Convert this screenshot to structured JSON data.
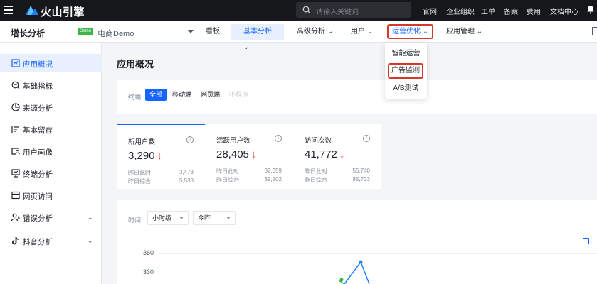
{
  "topbar": {
    "brand": "火山引擎",
    "search_placeholder": "请输入关键词",
    "links": [
      "官网",
      "企业组织",
      "工单",
      "备案",
      "费用",
      "文档中心"
    ]
  },
  "subbar": {
    "product": "增长分析",
    "badge": "Demo",
    "app_name": "电商Demo",
    "tabs": [
      "看板",
      "基本分析 ⌄",
      "高级分析 ⌄",
      "用户 ⌄",
      "运营优化 ⌄",
      "应用管理 ⌄"
    ],
    "highlighted_tab": "运营优化"
  },
  "sidebar": {
    "items": [
      {
        "label": "应用概况",
        "icon": "overview-icon"
      },
      {
        "label": "基础指标",
        "icon": "metrics-icon"
      },
      {
        "label": "来源分析",
        "icon": "source-icon"
      },
      {
        "label": "基本留存",
        "icon": "retention-icon"
      },
      {
        "label": "用户画像",
        "icon": "persona-icon"
      },
      {
        "label": "终端分析",
        "icon": "terminal-icon"
      },
      {
        "label": "网页访问",
        "icon": "webpage-icon"
      },
      {
        "label": "错误分析",
        "icon": "error-icon"
      },
      {
        "label": "抖音分析",
        "icon": "douyin-icon"
      }
    ],
    "active_index": 0
  },
  "main": {
    "title": "应用概况",
    "terminal_label": "终端:",
    "terminals": [
      "全部",
      "移动端",
      "网页端",
      "小程序"
    ],
    "metrics": [
      {
        "title": "新用户数",
        "value": "3,290",
        "trend": "↓",
        "cmp1_label": "昨日此时",
        "cmp1": "3,473",
        "cmp2_label": "昨日综合",
        "cmp2": "5,533"
      },
      {
        "title": "活跃用户数",
        "value": "28,405",
        "trend": "↓",
        "cmp1_label": "昨日此时",
        "cmp1": "32,359",
        "cmp2_label": "昨日综合",
        "cmp2": "39,202"
      },
      {
        "title": "访问次数",
        "value": "41,772",
        "trend": "↓",
        "cmp1_label": "昨日此时",
        "cmp1": "55,740",
        "cmp2_label": "昨日综合",
        "cmp2": "85,723"
      }
    ],
    "time_label": "时间:",
    "granularity": "小时级",
    "day": "今昨",
    "y_ticks": [
      "360",
      "330"
    ]
  },
  "dropdown": {
    "items": [
      "智能运营",
      "广告监测",
      "A/B测试"
    ],
    "highlighted": "广告监测"
  },
  "colors": {
    "accent": "#1664ff",
    "highlight_border": "#d43a2c",
    "down": "#e24a3b",
    "topbar": "#16171b"
  }
}
